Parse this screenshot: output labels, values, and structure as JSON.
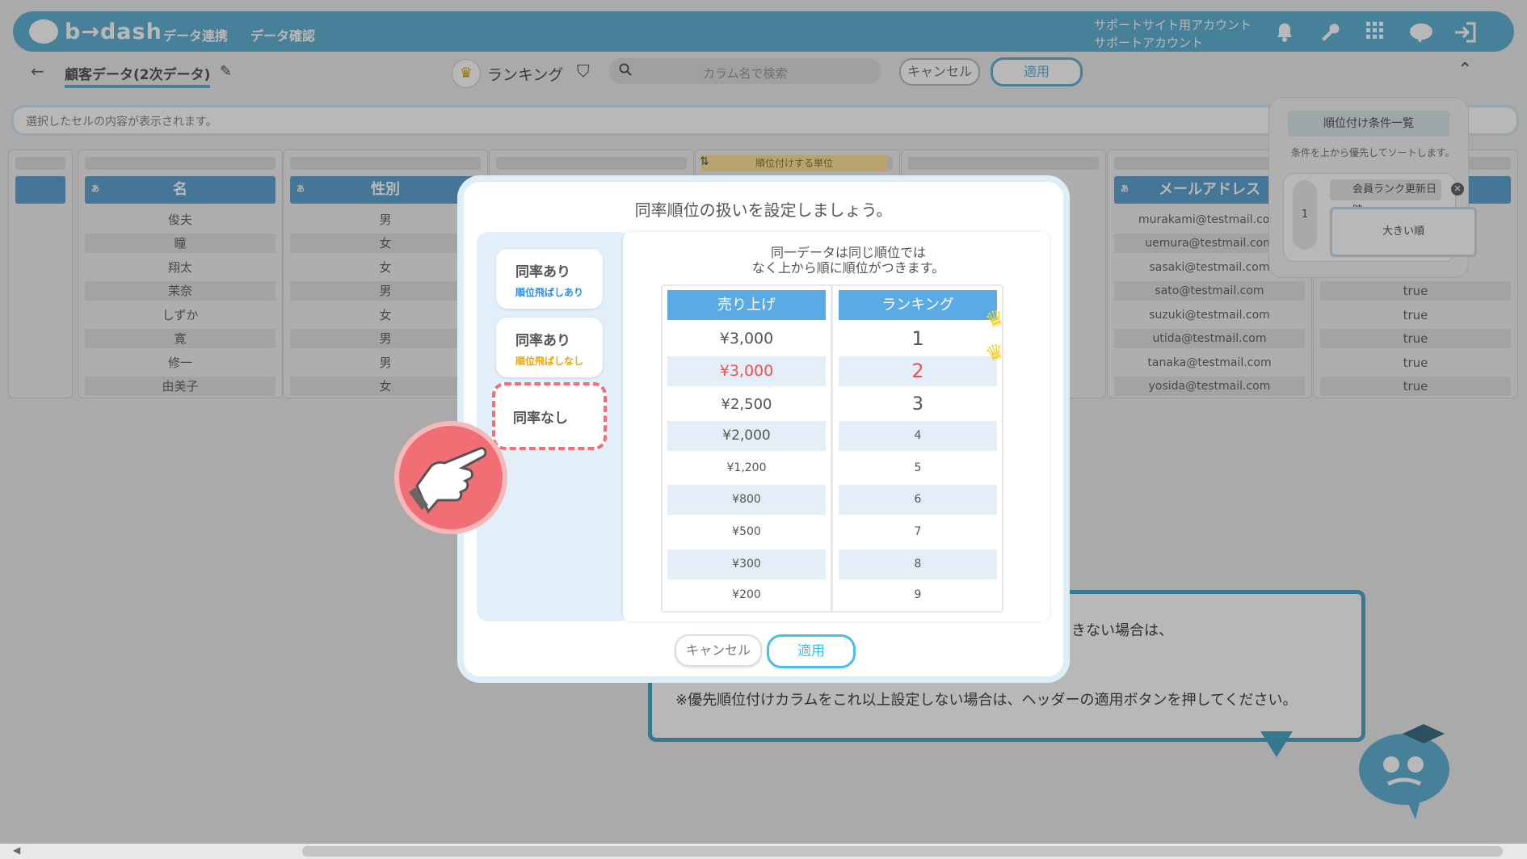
{
  "header": {
    "logo_text": "b→dash",
    "nav": [
      "データ連携",
      "データ確認"
    ],
    "account_line1": "サポートサイト用アカウント",
    "account_line2": "サポートアカウント",
    "icons": [
      "bell-icon",
      "wrench-icon",
      "apps-grid-icon",
      "brain-icon",
      "logout-icon"
    ],
    "brand_color": "#63b2d4"
  },
  "subbar": {
    "back_icon": "←",
    "dataset_name": "顧客データ(2次データ)",
    "mode_label": "ランキング",
    "search_placeholder": "カラム名で検索",
    "cancel_label": "キャンセル",
    "apply_label": "適用"
  },
  "cellbar": {
    "placeholder": "選択したセルの内容が表示されます。"
  },
  "grid": {
    "rank_unit_label": "順位付けする単位",
    "sort_icon": "⇅",
    "tag": "あ",
    "columns": [
      {
        "name": "名",
        "values": [
          "俊夫",
          "瞳",
          "翔太",
          "茉奈",
          "しずか",
          "寛",
          "修一",
          "由美子"
        ]
      },
      {
        "name": "性別",
        "values": [
          "男",
          "女",
          "女",
          "男",
          "女",
          "男",
          "男",
          "女"
        ]
      },
      {
        "name": "メールアドレス",
        "values": [
          "murakami@testmail.com",
          "uemura@testmail.com",
          "sasaki@testmail.com",
          "sato@testmail.com",
          "suzuki@testmail.com",
          "utida@testmail.com",
          "tanaka@testmail.com",
          "yosida@testmail.com"
        ]
      },
      {
        "name": "",
        "values": [
          "",
          "",
          "",
          "true",
          "true",
          "true",
          "true",
          "true"
        ]
      }
    ]
  },
  "rank_conditions": {
    "title": "順位付け条件一覧",
    "subtitle": "条件を上から優先してソートします。",
    "item_number": "1",
    "item_field": "会員ランク更新日時",
    "item_order": "大きい順"
  },
  "tooltip": {
    "line1": "きない場合は、",
    "line2": "※優先順位付けカラムをこれ以上設定しない場合は、ヘッダーの適用ボタンを押してください。"
  },
  "modal": {
    "title": "同率順位の扱いを設定しましょう。",
    "options": [
      {
        "title": "同率あり",
        "sub": "順位飛ばしあり",
        "sub_color": "#2f8ee0"
      },
      {
        "title": "同率あり",
        "sub": "順位飛ばしなし",
        "sub_color": "#f0a500"
      },
      {
        "title": "同率なし",
        "sub": ""
      }
    ],
    "description_line1": "同一データは同じ順位では",
    "description_line2": "なく上から順に順位がつきます。",
    "table": {
      "headers": [
        "売り上げ",
        "ランキング"
      ],
      "sales": [
        "¥3,000",
        "¥3,000",
        "¥2,500",
        "¥2,000",
        "¥1,200",
        "¥800",
        "¥500",
        "¥300",
        "¥200"
      ],
      "ranks": [
        "1",
        "2",
        "3",
        "4",
        "5",
        "6",
        "7",
        "8",
        "9"
      ],
      "highlight_color": "#f05050"
    },
    "cancel_label": "キャンセル",
    "apply_label": "適用"
  },
  "pointer": "👉"
}
